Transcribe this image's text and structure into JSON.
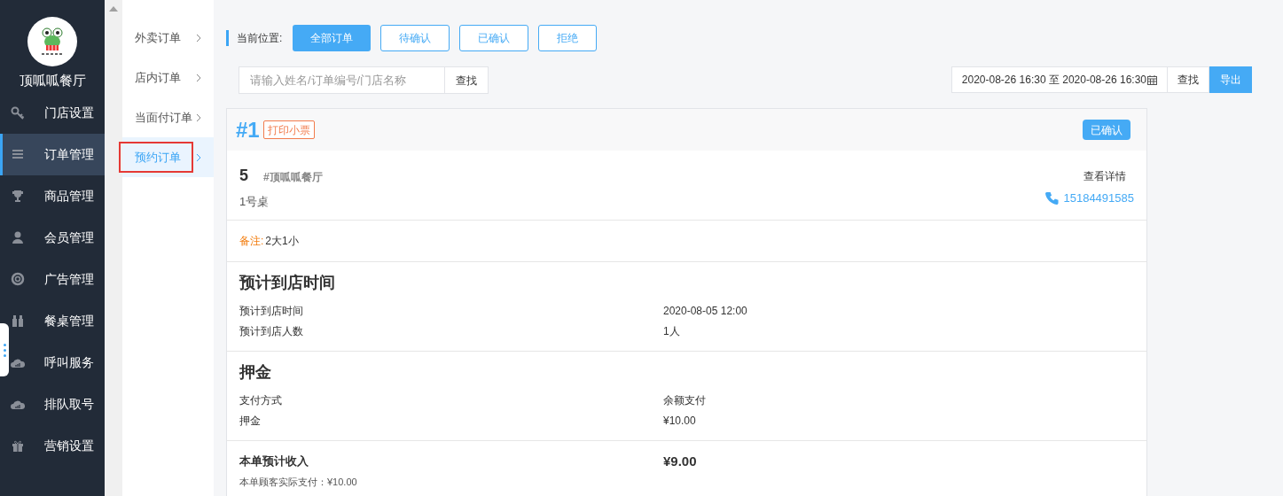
{
  "sidebar": {
    "store_name": "顶呱呱餐厅",
    "items": [
      {
        "label": "门店设置",
        "selected": false
      },
      {
        "label": "订单管理",
        "selected": true
      },
      {
        "label": "商品管理",
        "selected": false
      },
      {
        "label": "会员管理",
        "selected": false
      },
      {
        "label": "广告管理",
        "selected": false
      },
      {
        "label": "餐桌管理",
        "selected": false
      },
      {
        "label": "呼叫服务",
        "selected": false
      },
      {
        "label": "排队取号",
        "selected": false
      },
      {
        "label": "营销设置",
        "selected": false
      }
    ]
  },
  "subnav": {
    "items": [
      {
        "label": "外卖订单",
        "selected": false
      },
      {
        "label": "店内订单",
        "selected": false
      },
      {
        "label": "当面付订单",
        "selected": false
      },
      {
        "label": "预约订单",
        "selected": true
      }
    ]
  },
  "breadcrumb": {
    "label": "当前位置:",
    "filters": [
      {
        "label": "全部订单",
        "selected": true
      },
      {
        "label": "待确认",
        "selected": false
      },
      {
        "label": "已确认",
        "selected": false
      },
      {
        "label": "拒绝",
        "selected": false
      }
    ]
  },
  "search": {
    "placeholder": "请输入姓名/订单编号/门店名称",
    "button": "查找"
  },
  "date_filter": {
    "range": "2020-08-26 16:30 至 2020-08-26 16:30",
    "search_button": "查找",
    "export_button": "导出"
  },
  "order": {
    "number": "#1",
    "print_button": "打印小票",
    "status": "已确认",
    "count": "5",
    "store": "#顶呱呱餐厅",
    "table": "1号桌",
    "details_link": "查看详情",
    "phone": "15184491585",
    "note_label": "备注:",
    "note": "2大1小",
    "sections": [
      {
        "title": "预计到店时间",
        "rows": [
          [
            "预计到店时间",
            "2020-08-05 12:00"
          ],
          [
            "预计到店人数",
            "1人"
          ]
        ]
      },
      {
        "title": "押金",
        "rows": [
          [
            "支付方式",
            "余额支付"
          ],
          [
            "押金",
            "¥10.00"
          ]
        ]
      }
    ],
    "income_label": "本单预计收入",
    "income": "¥9.00",
    "paid_note": "本单顾客实际支付：¥10.00"
  }
}
